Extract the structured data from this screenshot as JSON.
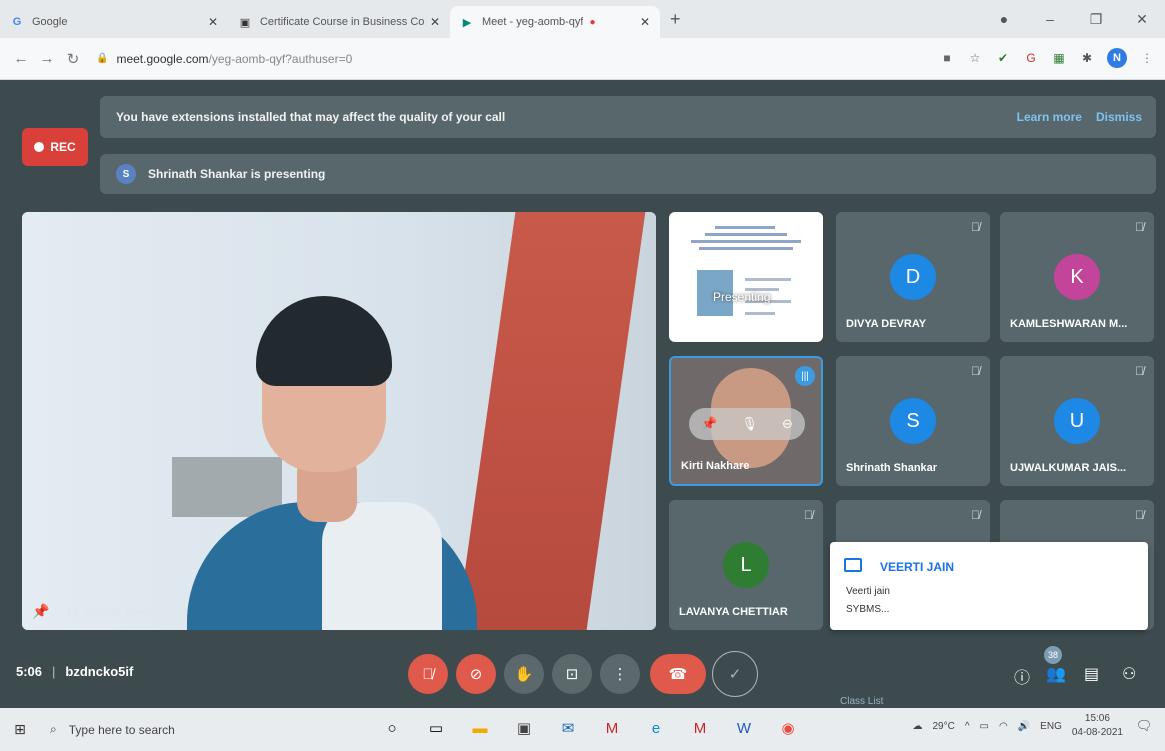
{
  "browser": {
    "tabs": [
      {
        "label": "Google",
        "icon": "G",
        "active": false
      },
      {
        "label": "Certificate Course in Business Co",
        "icon": "▣",
        "active": false
      },
      {
        "label": "Meet - yeg-aomb-qyf",
        "icon": "▶",
        "active": true
      }
    ],
    "new_tab": "+",
    "url_host": "meet.google.com",
    "url_rest": "/yeg-aomb-qyf?authuser=0",
    "profile_initial": "N"
  },
  "meet": {
    "rec_label": "REC",
    "extension_banner": "You have extensions installed that may affect the quality of your call",
    "learn_more": "Learn more",
    "dismiss": "Dismiss",
    "presenter_initial": "S",
    "presenting_text": "Shrinath Shankar is presenting",
    "main_speaker_name": "Dr. Vaishali Pawar",
    "slide_overlay": "Presenting",
    "participants": [
      {
        "initial": "D",
        "name": "DIVYA DEVRAY",
        "color": "#1e88e5"
      },
      {
        "initial": "K",
        "name": "KAMLESHWARAN M...",
        "color": "#c2459a"
      },
      {
        "initial": "S",
        "name": "Shrinath Shankar",
        "color": "#1e88e5"
      },
      {
        "initial": "U",
        "name": "UJWALKUMAR JAIS...",
        "color": "#1e88e5"
      },
      {
        "initial": "L",
        "name": "LAVANYA CHETTIAR",
        "color": "#2e7d32"
      }
    ],
    "kirti_name": "Kirti Nakhare",
    "chat_toast": {
      "sender": "VEERTI JAIN",
      "line1": "Veerti jain",
      "line2": "SYBMS..."
    },
    "time": "5:06",
    "meeting_code": "bzdncko5if",
    "participant_count": "38",
    "class_list": "Class List"
  },
  "taskbar": {
    "search_placeholder": "Type here to search",
    "weather": "29°C",
    "lang": "ENG",
    "time": "15:06",
    "date": "04-08-2021"
  }
}
